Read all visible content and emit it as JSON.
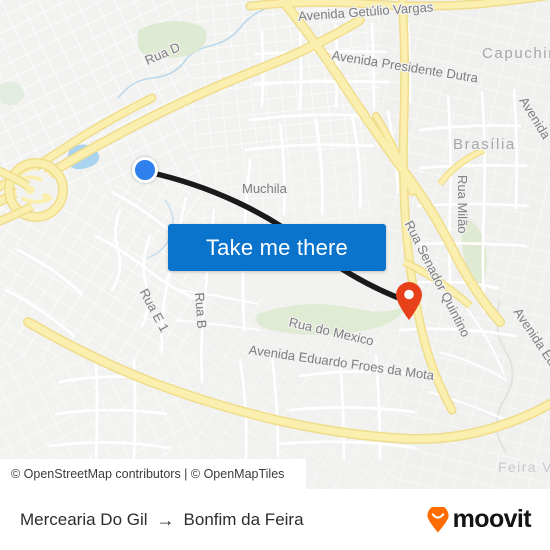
{
  "map": {
    "attribution": "© OpenStreetMap contributors | © OpenMapTiles",
    "labels": {
      "rua_d": "Rua D",
      "avenida_getulio_vargas": "Avenida Getúlio Vargas",
      "avenida_presidente_dutra": "Avenida Presidente Dutra",
      "capuchinhos": "Capuchinhos",
      "avenida_right_top": "Avenida",
      "brasilia": "Brasília",
      "muchila": "Muchila",
      "rua_milao": "Rua Milão",
      "rua_senador_quintino": "Rua Senador Quintino",
      "rua_e1": "Rua E 1",
      "rua_b": "Rua B",
      "rua_do_mexico": "Rua do Mexico",
      "avenida_eduardo_froes_da_mota": "Avenida Eduardo Froes da Mota",
      "avenida_right_bottom": "Avenida Edu",
      "feira_vii": "Feira VII"
    },
    "markers": {
      "origin_name": "origin-dot",
      "destination_name": "destination-pin"
    },
    "colors": {
      "route_line": "#1a1a1a",
      "origin_dot": "#2f7fec",
      "destination_pin": "#e8411a",
      "road_primary": "#fae79e",
      "road_minor": "#ffffff",
      "land": "#f2f2f0",
      "park": "#e0ebd4",
      "water": "#aad3f0"
    }
  },
  "cta": {
    "label": "Take me there"
  },
  "footer": {
    "origin": "Mercearia Do Gil",
    "arrow": "→",
    "destination": "Bonfim da Feira",
    "brand": "moovit",
    "brand_color": "#ff6d00"
  }
}
